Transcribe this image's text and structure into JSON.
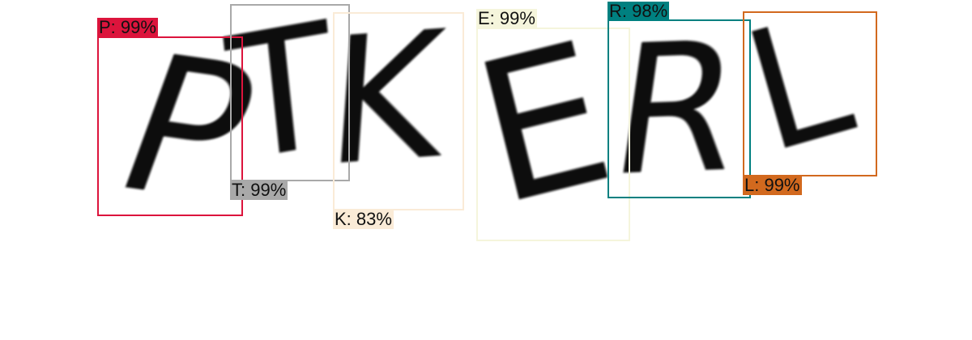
{
  "detections": [
    {
      "char": "P",
      "label": "P: 99%",
      "color": "#dc143c"
    },
    {
      "char": "T",
      "label": "T: 99%",
      "color": "#a9a9a9"
    },
    {
      "char": "K",
      "label": "K: 83%",
      "color": "#faebd7"
    },
    {
      "char": "E",
      "label": "E: 99%",
      "color": "#f5f5dc"
    },
    {
      "char": "R",
      "label": "R: 98%",
      "color": "#008080"
    },
    {
      "char": "L",
      "label": "L: 99%",
      "color": "#d2691e"
    }
  ]
}
